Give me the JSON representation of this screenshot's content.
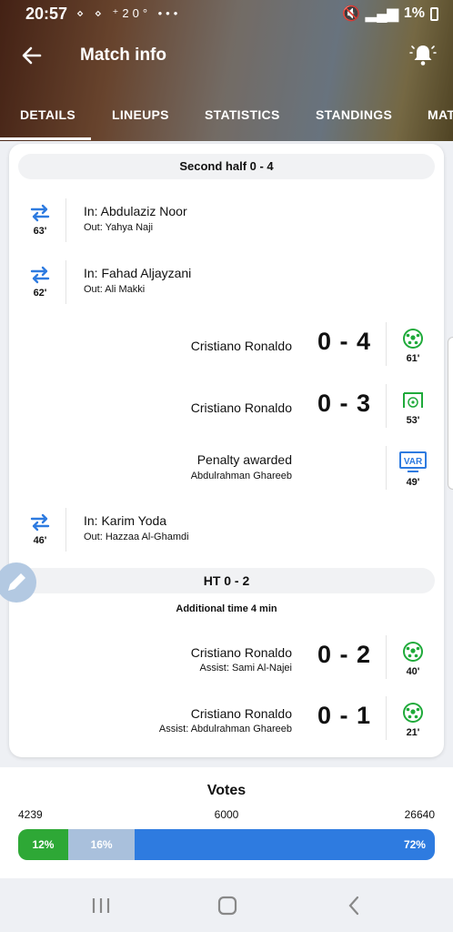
{
  "status_bar": {
    "time": "20:57",
    "left_icons": "⋄ ⋄ ⁺20° •••",
    "battery": "1%"
  },
  "header": {
    "title": "Match info"
  },
  "tabs": [
    {
      "label": "DETAILS",
      "active": true
    },
    {
      "label": "LINEUPS"
    },
    {
      "label": "STATISTICS"
    },
    {
      "label": "STANDINGS"
    },
    {
      "label": "MAT"
    }
  ],
  "timeline": {
    "second_half_label": "Second half 0 - 4",
    "substitutions": [
      {
        "minute": "63'",
        "in": "In: Abdulaziz Noor",
        "out": "Out: Yahya Naji"
      },
      {
        "minute": "62'",
        "in": "In: Fahad Aljayzani",
        "out": "Out: Ali Makki"
      },
      {
        "minute": "46'",
        "in": "In: Karim Yoda",
        "out": "Out: Hazzaa Al-Ghamdi"
      }
    ],
    "goals": [
      {
        "player": "Cristiano Ronaldo",
        "score": "0 - 4",
        "minute": "61'",
        "assist": ""
      },
      {
        "player": "Cristiano Ronaldo",
        "score": "0 - 3",
        "minute": "53'",
        "assist": ""
      },
      {
        "player": "Cristiano Ronaldo",
        "score": "0 - 2",
        "minute": "40'",
        "assist": "Assist: Sami Al-Najei"
      },
      {
        "player": "Cristiano Ronaldo",
        "score": "0 - 1",
        "minute": "21'",
        "assist": "Assist: Abdulrahman Ghareeb"
      }
    ],
    "var_event": {
      "title": "Penalty awarded",
      "player": "Abdulrahman Ghareeb",
      "minute": "49'",
      "badge": "VAR"
    },
    "ht_label": "HT 0 - 2",
    "additional_time": "Additional time 4 min"
  },
  "votes": {
    "title": "Votes",
    "home_count": "4239",
    "draw_count": "6000",
    "away_count": "26640",
    "home_pct": "12%",
    "draw_pct": "16%",
    "away_pct": "72%",
    "home_fraction": 0.12,
    "draw_fraction": 0.16,
    "away_fraction": 0.72
  },
  "colors": {
    "accent": "#2e7be0",
    "home": "#2ea836",
    "draw": "#a9c0dc",
    "away": "#2e7be0",
    "goal_green": "#1faa3a"
  }
}
